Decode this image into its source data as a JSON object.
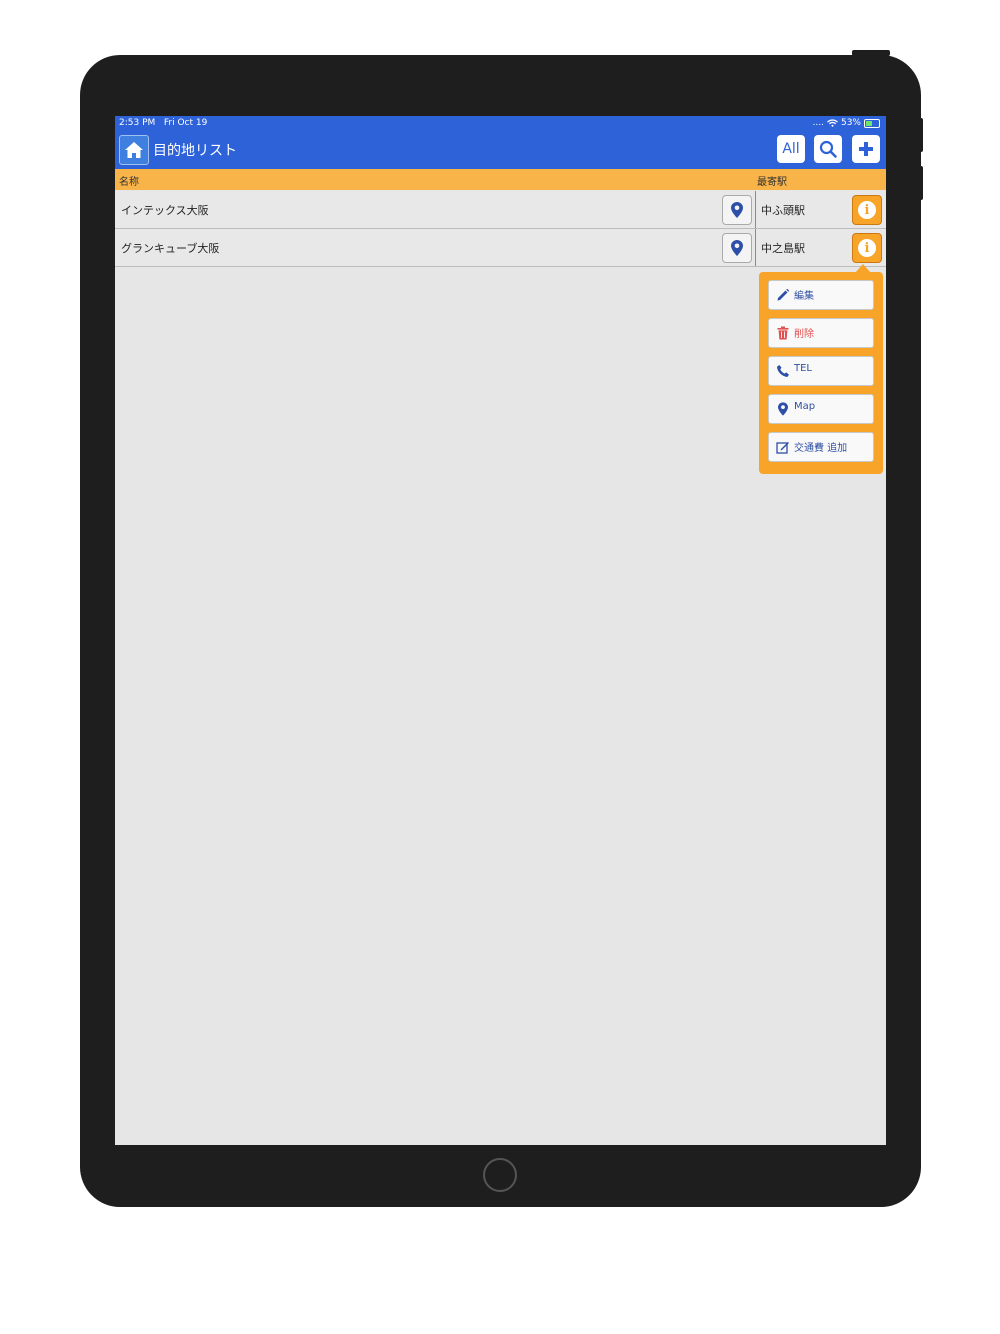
{
  "status_bar": {
    "time": "2:53 PM",
    "date": "Fri Oct 19",
    "signal": "....",
    "battery": "53%",
    "battery_level": 0.53
  },
  "navbar": {
    "title": "目的地リスト",
    "all_button": "All"
  },
  "columns": {
    "name": "名称",
    "station": "最寄駅"
  },
  "rows": [
    {
      "name": "インテックス大阪",
      "station": "中ふ頭駅"
    },
    {
      "name": "グランキューブ大阪",
      "station": "中之島駅"
    }
  ],
  "popover": {
    "items": [
      {
        "label": "編集",
        "icon": "pencil-icon"
      },
      {
        "label": "削除",
        "icon": "trash-icon"
      },
      {
        "label": "TEL",
        "icon": "phone-icon"
      },
      {
        "label": "Map",
        "icon": "map-pin-icon"
      },
      {
        "label": "交通費 追加",
        "icon": "edit-note-icon"
      }
    ]
  },
  "colors": {
    "accent_blue": "#2e62d9",
    "header_orange": "#f9b449",
    "info_orange": "#f7a428",
    "delete_red": "#e05050"
  }
}
